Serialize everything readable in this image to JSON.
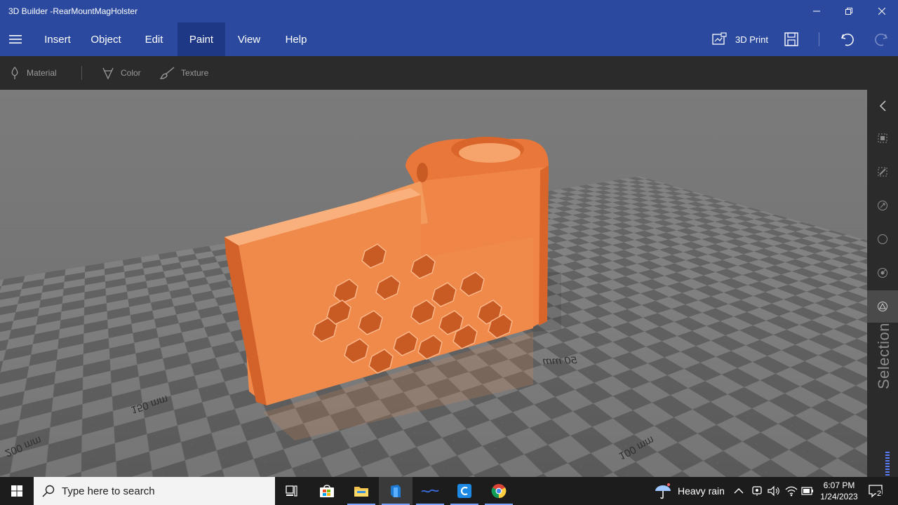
{
  "window": {
    "title": "3D Builder -RearMountMagHolster",
    "controls": [
      "minimize-icon",
      "restore-icon",
      "close-icon"
    ]
  },
  "menu": {
    "items": [
      {
        "label": "Insert"
      },
      {
        "label": "Object"
      },
      {
        "label": "Edit"
      },
      {
        "label": "Paint",
        "active": true
      },
      {
        "label": "View"
      },
      {
        "label": "Help"
      }
    ],
    "print_label": "3D Print"
  },
  "paint_toolbar": {
    "material_label": "Material",
    "color_label": "Color",
    "texture_label": "Texture"
  },
  "viewport": {
    "scale_labels": [
      "50 mm",
      "100 mm",
      "150 mm",
      "200 mm"
    ],
    "model_color": "#f08a4b"
  },
  "right_panel": {
    "label": "Selection",
    "buttons": [
      "collapse-arrow-icon",
      "select-objects-icon",
      "select-faces-icon",
      "select-edges-icon",
      "select-vertices-icon",
      "select-mesh-icon",
      "select-mode-icon"
    ]
  },
  "taskbar": {
    "search_placeholder": "Type here to search",
    "apps": [
      "task-view-icon",
      "store-icon",
      "file-explorer-icon",
      "3d-builder-icon",
      "app-icon",
      "cortana-icon",
      "chrome-icon"
    ],
    "weather": "Heavy rain",
    "time": "6:07 PM",
    "date": "1/24/2023",
    "notification_count": "2"
  },
  "colors": {
    "accent": "#2b4a9f",
    "accent_active": "#1e3886",
    "toolbar": "#2b2b2b",
    "model": "#f08a4b"
  }
}
